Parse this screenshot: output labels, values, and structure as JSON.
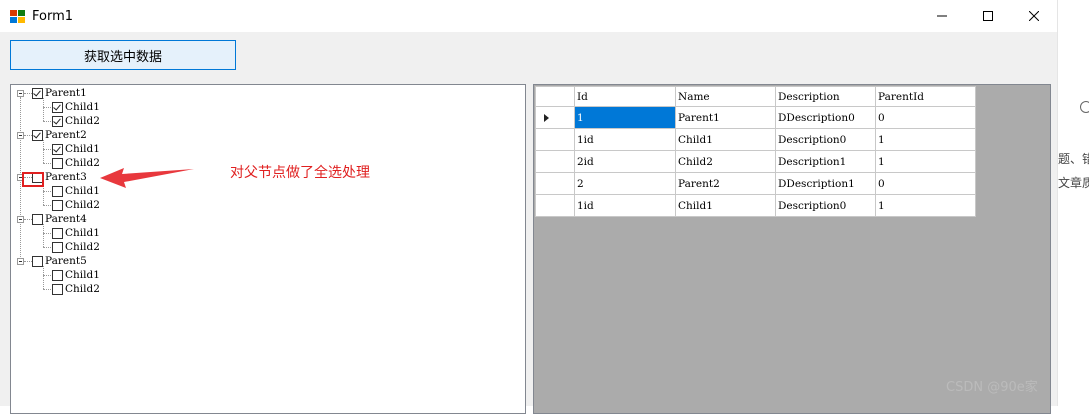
{
  "window": {
    "title": "Form1"
  },
  "toolbar": {
    "fetch_label": "获取选中数据"
  },
  "tree": {
    "nodes": [
      {
        "label": "Parent1",
        "checked": true,
        "children": [
          {
            "label": "Child1",
            "checked": true
          },
          {
            "label": "Child2",
            "checked": true
          }
        ]
      },
      {
        "label": "Parent2",
        "checked": true,
        "children": [
          {
            "label": "Child1",
            "checked": true
          },
          {
            "label": "Child2",
            "checked": false
          }
        ]
      },
      {
        "label": "Parent3",
        "checked": false,
        "children": [
          {
            "label": "Child1",
            "checked": false
          },
          {
            "label": "Child2",
            "checked": false
          }
        ]
      },
      {
        "label": "Parent4",
        "checked": false,
        "children": [
          {
            "label": "Child1",
            "checked": false
          },
          {
            "label": "Child2",
            "checked": false
          }
        ]
      },
      {
        "label": "Parent5",
        "checked": false,
        "children": [
          {
            "label": "Child1",
            "checked": false
          },
          {
            "label": "Child2",
            "checked": false
          }
        ]
      }
    ]
  },
  "grid": {
    "columns": [
      "Id",
      "Name",
      "Description",
      "ParentId"
    ],
    "rows": [
      [
        "1",
        "Parent1",
        "DDescription0",
        "0"
      ],
      [
        "1id",
        "Child1",
        "Description0",
        "1"
      ],
      [
        "2id",
        "Child2",
        "Description1",
        "1"
      ],
      [
        "2",
        "Parent2",
        "DDescription1",
        "0"
      ],
      [
        "1id",
        "Child1",
        "Description0",
        "1"
      ]
    ]
  },
  "annotation": {
    "text": "对父节点做了全选处理"
  },
  "sidebar": {
    "line1": "题、错",
    "line2": "文章质"
  },
  "watermark": {
    "text": "CSDN @90e家"
  },
  "colors": {
    "accent": "#0078d7",
    "annotation": "#e02020"
  }
}
